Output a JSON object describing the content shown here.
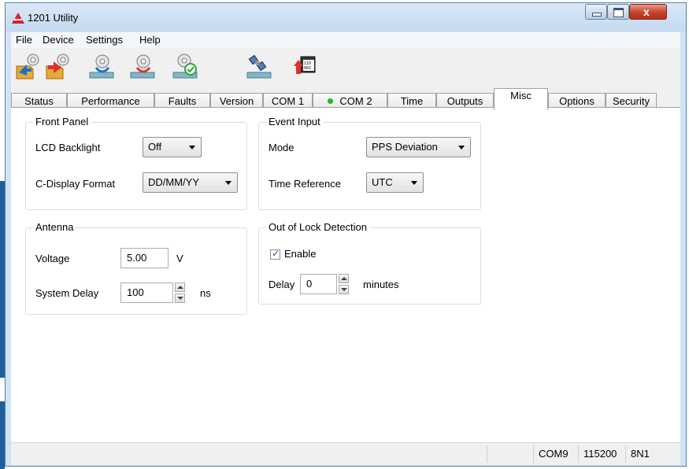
{
  "window": {
    "title": "1201 Utility"
  },
  "menu": [
    "File",
    "Device",
    "Settings",
    "Help"
  ],
  "toolbar": [
    "open-config-icon",
    "save-config-icon",
    "read-settings-icon",
    "write-settings-icon",
    "verify-settings-icon",
    "gps-satellite-icon",
    "firmware-upload-icon"
  ],
  "tabs": [
    "Status",
    "Performance",
    "Faults",
    "Version",
    "COM 1",
    "COM 2",
    "Time",
    "Outputs",
    "Misc",
    "Options",
    "Security"
  ],
  "active_tab": "Misc",
  "front_panel": {
    "title": "Front Panel",
    "lcd_label": "LCD Backlight",
    "lcd_value": "Off",
    "cdisplay_label": "C-Display Format",
    "cdisplay_value": "DD/MM/YY"
  },
  "event_input": {
    "title": "Event Input",
    "mode_label": "Mode",
    "mode_value": "PPS Deviation",
    "timeref_label": "Time Reference",
    "timeref_value": "UTC"
  },
  "antenna": {
    "title": "Antenna",
    "voltage_label": "Voltage",
    "voltage_value": "5.00",
    "voltage_unit": "V",
    "delay_label": "System Delay",
    "delay_value": "100",
    "delay_unit": "ns"
  },
  "out_of_lock": {
    "title": "Out of Lock Detection",
    "enable_label": "Enable",
    "enable_checked": true,
    "delay_label": "Delay",
    "delay_value": "0",
    "delay_unit": "minutes"
  },
  "statusbar": {
    "port": "COM9",
    "baud": "115200",
    "format": "8N1"
  },
  "colors": {
    "titlebar": "#c3d9ef",
    "close": "#c4432b",
    "status_dot": "#1fbb1f"
  }
}
